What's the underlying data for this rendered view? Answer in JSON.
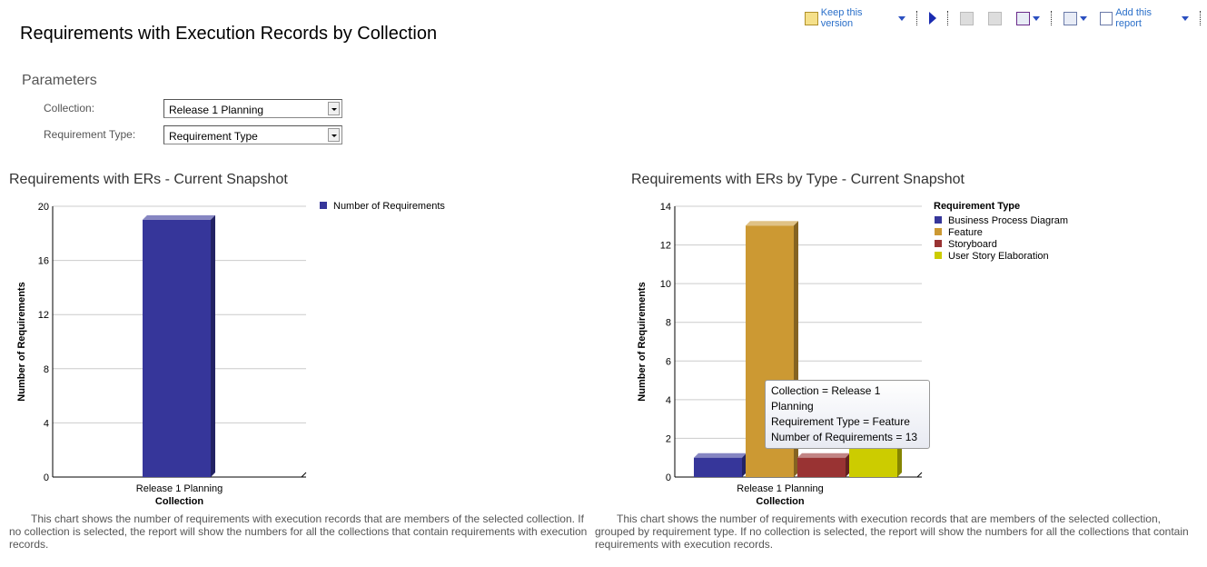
{
  "page": {
    "title": "Requirements with Execution Records by Collection"
  },
  "toolbar": {
    "keep_version": "Keep this version",
    "add_report": "Add this report"
  },
  "parameters": {
    "heading": "Parameters",
    "collection_label": "Collection:",
    "collection_value": "Release 1 Planning",
    "type_label": "Requirement Type:",
    "type_value": "Requirement Type"
  },
  "left": {
    "title": "Requirements with ERs - Current Snapshot",
    "description": "This chart shows the number of requirements with execution records that are members of the selected collection. If no collection is selected, the report will show the numbers for all the collections that contain requirements with execution records."
  },
  "right": {
    "title": "Requirements with ERs by Type -  Current Snapshot",
    "description": "This chart shows the number of requirements with execution records that are members of the selected collection, grouped by requirement type. If no collection is selected, the report will show the numbers for all the collections that contain requirements with execution records."
  },
  "tooltip": {
    "line1": "Collection = Release 1 Planning",
    "line2": "Requirement Type = Feature",
    "line3": "Number of Requirements = 13"
  },
  "chart_data": [
    {
      "type": "bar",
      "categories": [
        "Release 1 Planning"
      ],
      "xlabel": "Collection",
      "ylabel": "Number of Requirements",
      "ylim": [
        0,
        20
      ],
      "yticks": [
        0,
        4,
        8,
        12,
        16,
        20
      ],
      "grid": true,
      "legend_placement": "right",
      "series": [
        {
          "name": "Number of Requirements",
          "values": [
            19
          ],
          "color": "#36369a"
        }
      ]
    },
    {
      "type": "bar",
      "categories": [
        "Release 1 Planning"
      ],
      "xlabel": "Collection",
      "ylabel": "Number of Requirements",
      "ylim": [
        0,
        14
      ],
      "yticks": [
        0,
        2,
        4,
        6,
        8,
        10,
        12,
        14
      ],
      "grid": true,
      "legend_placement": "right",
      "legend_title": "Requirement Type",
      "series": [
        {
          "name": "Business Process Diagram",
          "values": [
            1
          ],
          "color": "#36369a"
        },
        {
          "name": "Feature",
          "values": [
            13
          ],
          "color": "#cc9933"
        },
        {
          "name": "Storyboard",
          "values": [
            1
          ],
          "color": "#993333"
        },
        {
          "name": "User Story Elaboration",
          "values": [
            4
          ],
          "color": "#cccc00"
        }
      ]
    }
  ]
}
